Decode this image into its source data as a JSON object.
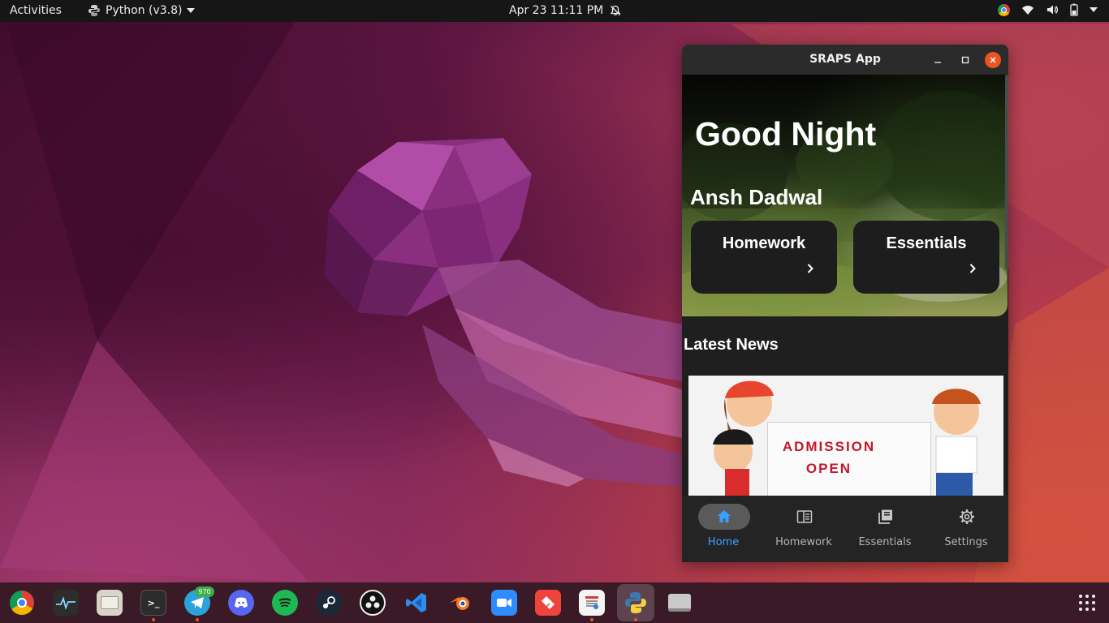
{
  "topbar": {
    "activities": "Activities",
    "app_menu": "Python (v3.8)",
    "clock": "Apr 23  11:11 PM"
  },
  "dock": {
    "telegram_badge": "970",
    "items": [
      "chrome",
      "system-monitor",
      "files",
      "terminal",
      "telegram",
      "discord",
      "spotify",
      "steam",
      "obs",
      "vscode",
      "blender",
      "zoom",
      "anydesk",
      "text-editor",
      "python",
      "drive"
    ]
  },
  "window": {
    "title": "SRAPS App",
    "greeting": "Good Night",
    "username": "Ansh Dadwal",
    "cards": [
      {
        "label": "Homework"
      },
      {
        "label": "Essentials"
      }
    ],
    "news": {
      "heading": "Latest News",
      "banner_line1": "ADMISSION",
      "banner_line2": "OPEN"
    },
    "nav": [
      {
        "label": "Home",
        "icon": "home-icon",
        "active": true
      },
      {
        "label": "Homework",
        "icon": "homework-icon"
      },
      {
        "label": "Essentials",
        "icon": "essentials-icon"
      },
      {
        "label": "Settings",
        "icon": "gear-icon"
      }
    ],
    "accent": "#3aa0ff"
  }
}
